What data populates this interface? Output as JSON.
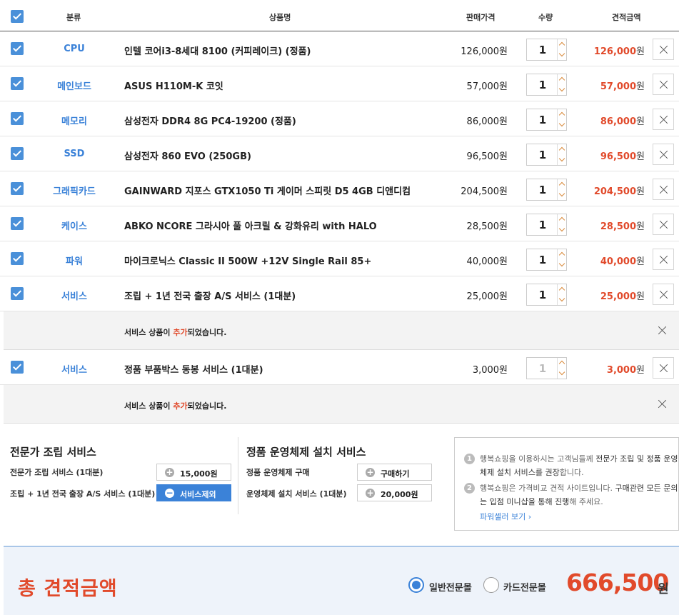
{
  "header": {
    "category": "분류",
    "product": "상품명",
    "price": "판매가격",
    "quantity": "수량",
    "estimate": "견적금액"
  },
  "items": [
    {
      "category": "CPU",
      "name": "인텔 코어i3-8세대 8100 (커피레이크) (정품)",
      "price": "126,000원",
      "qty": "1",
      "total": "126,000",
      "won": "원"
    },
    {
      "category": "메인보드",
      "name": "ASUS H110M-K 코잇",
      "price": "57,000원",
      "qty": "1",
      "total": "57,000",
      "won": "원"
    },
    {
      "category": "메모리",
      "name": "삼성전자 DDR4 8G PC4-19200 (정품)",
      "price": "86,000원",
      "qty": "1",
      "total": "86,000",
      "won": "원"
    },
    {
      "category": "SSD",
      "name": "삼성전자 860 EVO (250GB)",
      "price": "96,500원",
      "qty": "1",
      "total": "96,500",
      "won": "원"
    },
    {
      "category": "그래픽카드",
      "name": "GAINWARD 지포스 GTX1050 Ti 게이머 스피릿 D5 4GB 디앤디컴",
      "price": "204,500원",
      "qty": "1",
      "total": "204,500",
      "won": "원"
    },
    {
      "category": "케이스",
      "name": "ABKO NCORE 그라시아 풀 아크릴 & 강화유리 with HALO",
      "price": "28,500원",
      "qty": "1",
      "total": "28,500",
      "won": "원"
    },
    {
      "category": "파워",
      "name": "마이크로닉스 Classic II 500W +12V Single Rail 85+",
      "price": "40,000원",
      "qty": "1",
      "total": "40,000",
      "won": "원"
    },
    {
      "category": "서비스",
      "name": "조립 + 1년 전국 출장 A/S 서비스 (1대분)",
      "price": "25,000원",
      "qty": "1",
      "total": "25,000",
      "won": "원"
    },
    {
      "category": "서비스",
      "name": "정품 부품박스 동봉 서비스 (1대분)",
      "price": "3,000원",
      "qty": "1",
      "total": "3,000",
      "won": "원"
    }
  ],
  "notices": [
    {
      "pre": "서비스 상품이 ",
      "hl": "추가",
      "post": "되었습니다."
    },
    {
      "pre": "서비스 상품이 ",
      "hl": "추가",
      "post": "되었습니다."
    }
  ],
  "assembly": {
    "title": "전문가 조립 서비스",
    "row1_label": "전문가 조립 서비스 (1대분)",
    "row1_btn": "15,000원",
    "row2_label": "조립 + 1년 전국 출장 A/S 서비스 (1대분)",
    "row2_btn": "서비스제외"
  },
  "os": {
    "title": "정품 운영체제 설치 서비스",
    "row1_label": "정품 운영체제 구매",
    "row1_btn": "구매하기",
    "row2_label": "운영체제 설치 서비스 (1대분)",
    "row2_btn": "20,000원"
  },
  "info": {
    "item1_num": "1",
    "item1_a": "행복쇼핑을 이용하시는 고객님들께 ",
    "item1_b": "전문가 조립 및 정품 운영체제 설치 서비스를 권장",
    "item1_c": "합니다.",
    "item2_num": "2",
    "item2_a": "행복쇼핑은 가격비교 견적 사이트입니다. ",
    "item2_b": "구매관련 모든 문의는 입점 미니샵을 통해 진행",
    "item2_c": "해 주세요.",
    "link": "파워셀러 보기 ›"
  },
  "total": {
    "label": "총 견적금액",
    "option1": "일반전문몰",
    "option2": "카드전문몰",
    "amount": "666,500",
    "unit": "원"
  },
  "colors": {
    "accent_blue": "#3b82d8",
    "price_red": "#e14a2b"
  }
}
